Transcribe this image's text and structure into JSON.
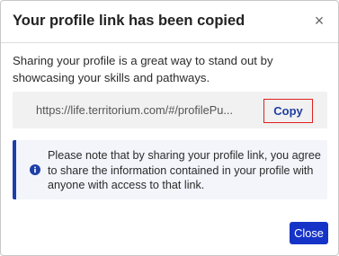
{
  "dialog": {
    "title": "Your profile link has been copied",
    "close_glyph": "×",
    "close_icon": "close-icon",
    "description": "Sharing your profile is a great way to stand out by showcasing your skills and pathways.",
    "link_text": "https://life.territorium.com/#/profilePu...",
    "copy_label": "Copy",
    "notice": {
      "icon": "info-circle-icon",
      "text": "Please note that by sharing your profile link, you agree to share the information contained in your profile with anyone with access to that link."
    },
    "footer_close_label": "Close"
  },
  "colors": {
    "accent": "#1534c7",
    "notice_border": "#1e3fa8",
    "notice_bg": "#f3f5fb",
    "copy_highlight": "#e02020",
    "link_box_bg": "#f1f1f1"
  }
}
